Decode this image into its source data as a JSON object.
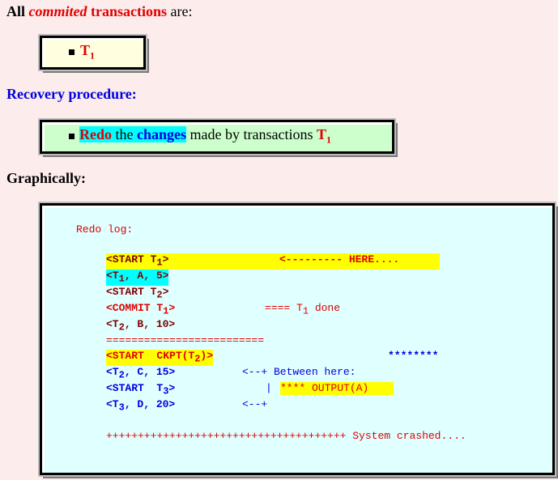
{
  "heading1": {
    "prefix": "All ",
    "emph": "commited",
    "mid": " transactions",
    "suffix": " are:"
  },
  "box1": {
    "t_label": "T",
    "t_sub": "1"
  },
  "heading2": {
    "text": "Recovery procedure:"
  },
  "box2": {
    "redo": "Redo",
    "the": " the ",
    "changes": "changes",
    "rest": " made by transactions ",
    "t_label": "T",
    "t_sub": "1"
  },
  "heading3": {
    "text": "Graphically:"
  },
  "log": {
    "title": "Redo log:",
    "r1_a": "<START T",
    "r1_sub": "1",
    "r1_b": ">",
    "here": "<--------- HERE....",
    "r2_a": "<T",
    "r2_sub": "1",
    "r2_b": ", A, 5>",
    "r3_a": "<START T",
    "r3_sub": "2",
    "r3_b": ">",
    "r4_a": "<COMMIT T",
    "r4_sub": "1",
    "r4_b": ">",
    "done_a": "==== T",
    "done_sub": "1",
    "done_b": " done",
    "r5_a": "<T",
    "r5_sub": "2",
    "r5_b": ", B, 10>",
    "sep": "=========================",
    "r6_a": "<START  CKPT(T",
    "r6_sub": "2",
    "r6_b": ")>",
    "stars": "********",
    "r7_a": "<T",
    "r7_sub": "2",
    "r7_b": ", C, 15>",
    "between": "<--+ Between here:",
    "r8_a": "<START  T",
    "r8_sub": "3",
    "r8_b": ">",
    "pipe": "|",
    "output": "**** OUTPUT(A)",
    "r9_a": "<T",
    "r9_sub": "3",
    "r9_b": ", D, 20>",
    "arrow_end": "<--+",
    "crash": "++++++++++++++++++++++++++++++++++++++ System crashed...."
  }
}
